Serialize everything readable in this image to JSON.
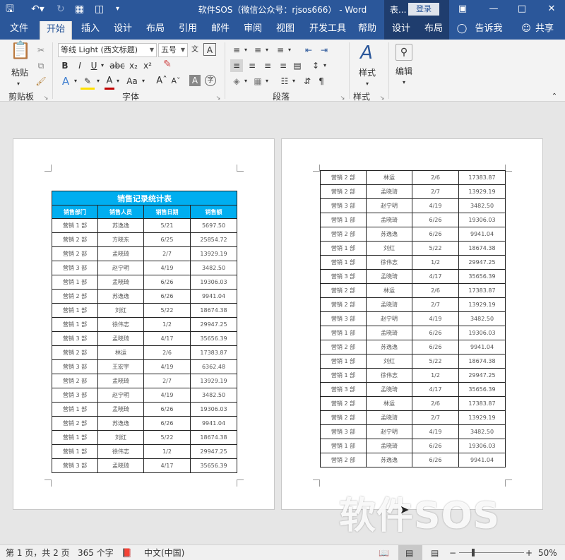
{
  "titlebar": {
    "title": "软件SOS（微信公众号：rjsos666） - Word",
    "context_label": "表...",
    "signin": "登录"
  },
  "tabs": [
    "文件",
    "开始",
    "插入",
    "设计",
    "布局",
    "引用",
    "邮件",
    "审阅",
    "视图",
    "开发工具",
    "帮助",
    "设计",
    "布局"
  ],
  "active_tab": "开始",
  "tell_me": "告诉我",
  "share": "共享",
  "ribbon": {
    "paste_label": "粘贴",
    "font_name": "等线 Light (西文标题)",
    "font_size": "五号",
    "bold": "B",
    "italic": "I",
    "underline": "U",
    "strike": "abc",
    "subscript": "x₂",
    "superscript": "x²",
    "styles_label": "样式",
    "editing_label": "编辑",
    "groups": [
      "剪贴板",
      "字体",
      "段落",
      "样式"
    ]
  },
  "table": {
    "title": "销售记录统计表",
    "headers": [
      "销售部门",
      "销售人员",
      "销售日期",
      "销售额"
    ]
  },
  "page1_rows": [
    [
      "营销 1 部",
      "苏逸逸",
      "5/21",
      "5697.50"
    ],
    [
      "营销 2 部",
      "方晓东",
      "6/25",
      "25854.72"
    ],
    [
      "营销 2 部",
      "孟晓琦",
      "2/7",
      "13929.19"
    ],
    [
      "营销 3 部",
      "赵宁明",
      "4/19",
      "3482.50"
    ],
    [
      "营销 1 部",
      "孟晓琦",
      "6/26",
      "19306.03"
    ],
    [
      "营销 2 部",
      "苏逸逸",
      "6/26",
      "9941.04"
    ],
    [
      "营销 1 部",
      "刘红",
      "5/22",
      "18674.38"
    ],
    [
      "营销 1 部",
      "徐伟志",
      "1/2",
      "29947.25"
    ],
    [
      "营销 3 部",
      "孟晓琦",
      "4/17",
      "35656.39"
    ],
    [
      "营销 2 部",
      "林运",
      "2/6",
      "17383.87"
    ],
    [
      "营销 3 部",
      "王宏宇",
      "4/19",
      "6362.48"
    ],
    [
      "营销 2 部",
      "孟晓琦",
      "2/7",
      "13929.19"
    ],
    [
      "营销 3 部",
      "赵宁明",
      "4/19",
      "3482.50"
    ],
    [
      "营销 1 部",
      "孟晓琦",
      "6/26",
      "19306.03"
    ],
    [
      "营销 2 部",
      "苏逸逸",
      "6/26",
      "9941.04"
    ],
    [
      "营销 1 部",
      "刘红",
      "5/22",
      "18674.38"
    ],
    [
      "营销 1 部",
      "徐伟志",
      "1/2",
      "29947.25"
    ],
    [
      "营销 3 部",
      "孟晓琦",
      "4/17",
      "35656.39"
    ]
  ],
  "page2_rows": [
    [
      "营销 2 部",
      "林运",
      "2/6",
      "17383.87"
    ],
    [
      "营销 2 部",
      "孟晓琦",
      "2/7",
      "13929.19"
    ],
    [
      "营销 3 部",
      "赵宁明",
      "4/19",
      "3482.50"
    ],
    [
      "营销 1 部",
      "孟晓琦",
      "6/26",
      "19306.03"
    ],
    [
      "营销 2 部",
      "苏逸逸",
      "6/26",
      "9941.04"
    ],
    [
      "营销 1 部",
      "刘红",
      "5/22",
      "18674.38"
    ],
    [
      "营销 1 部",
      "徐伟志",
      "1/2",
      "29947.25"
    ],
    [
      "营销 3 部",
      "孟晓琦",
      "4/17",
      "35656.39"
    ],
    [
      "营销 2 部",
      "林运",
      "2/6",
      "17383.87"
    ],
    [
      "营销 2 部",
      "孟晓琦",
      "2/7",
      "13929.19"
    ],
    [
      "营销 3 部",
      "赵宁明",
      "4/19",
      "3482.50"
    ],
    [
      "营销 1 部",
      "孟晓琦",
      "6/26",
      "19306.03"
    ],
    [
      "营销 2 部",
      "苏逸逸",
      "6/26",
      "9941.04"
    ],
    [
      "营销 1 部",
      "刘红",
      "5/22",
      "18674.38"
    ],
    [
      "营销 1 部",
      "徐伟志",
      "1/2",
      "29947.25"
    ],
    [
      "营销 3 部",
      "孟晓琦",
      "4/17",
      "35656.39"
    ],
    [
      "营销 2 部",
      "林运",
      "2/6",
      "17383.87"
    ],
    [
      "营销 2 部",
      "孟晓琦",
      "2/7",
      "13929.19"
    ],
    [
      "营销 3 部",
      "赵宁明",
      "4/19",
      "3482.50"
    ],
    [
      "营销 1 部",
      "孟晓琦",
      "6/26",
      "19306.03"
    ],
    [
      "营销 2 部",
      "苏逸逸",
      "6/26",
      "9941.04"
    ]
  ],
  "watermark": "软件SOS",
  "status": {
    "page": "第 1 页，共 2 页",
    "words": "365 个字",
    "language": "中文(中国)",
    "zoom": "50%"
  }
}
